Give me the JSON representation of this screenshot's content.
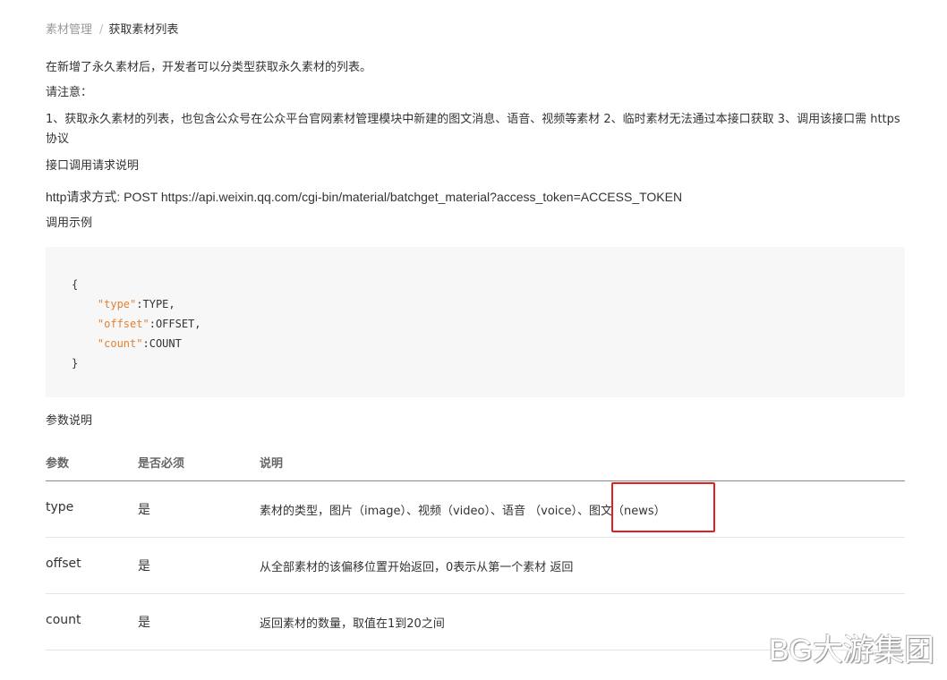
{
  "breadcrumb": {
    "root": "素材管理",
    "separator": "/",
    "current": "获取素材列表"
  },
  "intro": "在新增了永久素材后，开发者可以分类型获取永久素材的列表。",
  "note_label": "请注意：",
  "note_body": "1、获取永久素材的列表，也包含公众号在公众平台官网素材管理模块中新建的图文消息、语音、视频等素材 2、临时素材无法通过本接口获取 3、调用该接口需 https 协议",
  "api_heading": "接口调用请求说明",
  "http_request": "http请求方式: POST https://api.weixin.qq.com/cgi-bin/material/batchget_material?access_token=ACCESS_TOKEN",
  "example_heading": "调用示例",
  "code": {
    "open": "{",
    "lines": [
      {
        "key": "\"type\"",
        "sep": ":",
        "value": "TYPE,"
      },
      {
        "key": "\"offset\"",
        "sep": ":",
        "value": "OFFSET,"
      },
      {
        "key": "\"count\"",
        "sep": ":",
        "value": "COUNT"
      }
    ],
    "close": "}",
    "key_color": "#e5812f"
  },
  "params_heading": "参数说明",
  "table": {
    "headers": [
      "参数",
      "是否必须",
      "说明"
    ],
    "rows": [
      {
        "param": "type",
        "required": "是",
        "desc": "素材的类型，图片（image）、视频（video）、语音 （voice）、图文（news）"
      },
      {
        "param": "offset",
        "required": "是",
        "desc": "从全部素材的该偏移位置开始返回，0表示从第一个素材 返回"
      },
      {
        "param": "count",
        "required": "是",
        "desc": "返回素材的数量，取值在1到20之间"
      }
    ]
  },
  "highlight_color": "#e02020",
  "watermark": "BG大游集团"
}
